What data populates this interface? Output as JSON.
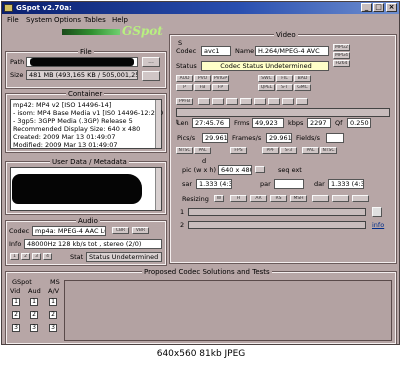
{
  "window": {
    "title": "GSpot v2.70a: "
  },
  "menu": [
    "File",
    "System",
    "Options",
    "Tables",
    "Help"
  ],
  "logo_text": "GSpot",
  "file": {
    "section_title": "File",
    "path_label": "Path",
    "size_label": "Size",
    "size_value": "481 MB (493,165 KB / 505,001,258",
    "button_dots": "..."
  },
  "container": {
    "section_title": "Container",
    "lines": [
      "mp42: MP4 v2 [ISO 14496-14]",
      "- isom: MP4  Base Media v1 [IS0 14496-12:200",
      "- 3gp5: 3GPP Media (.3GP) Release 5",
      "Recommended Display Size: 640 x 480",
      "Created:   2009 Mar 13   01:49:07",
      "Modified:  2009 Mar 13   01:49:07"
    ]
  },
  "metadata": {
    "section_title": "User Data / Metadata"
  },
  "audio": {
    "section_title": "Audio",
    "codec_label": "Codec",
    "codec_value": "mp4a: MPEG-4 AAC LC",
    "info_label": "Info",
    "info_value": "48000Hz  128 kb/s tot , stereo (2/0)",
    "status_label": "Stat",
    "status_value": "Status Undetermined",
    "buttons": [
      "CBR",
      "VBR"
    ],
    "tab_buttons": [
      "1",
      "2",
      "3",
      "4"
    ]
  },
  "video": {
    "section_title": "Video",
    "s_label": "S",
    "codec_label": "Codec",
    "codec_value": "avc1",
    "name_label": "Name",
    "name_value": "H.264/MPEG-4 AVC",
    "status_label": "Status",
    "status_value": "Codec Status Undetermined",
    "top_buttons": [
      "MPG2",
      "MPG4",
      "H264"
    ],
    "row1_buttons": [
      "AUD",
      "PVO",
      "PVIGP",
      "SWC",
      "FIL",
      "BAD"
    ],
    "row2_buttons": [
      "P",
      "FB",
      "FP",
      "QPEL",
      "S-T",
      "GMC"
    ],
    "row3_buttons": [
      "PPFB",
      "",
      "",
      "",
      "",
      "",
      "",
      "",
      ""
    ],
    "t_label": "t",
    "len_label": "Len",
    "len_value": "27:45.76",
    "frms_label": "Frms",
    "frms_value": "49,923",
    "kbps_label": "kbps",
    "kbps_value": "2297",
    "qf_label": "Qf",
    "qf_value": "0.250",
    "pics_label": "Pics/s",
    "pics_value": "29.961",
    "framers_label": "Frames/s",
    "framers_value": "29.961",
    "fields_label": "Fields/s",
    "mid_buttons": [
      "NTSC",
      "PAL",
      "FPS",
      "PPF",
      "S-3",
      "PAL",
      "NTSC"
    ],
    "d_label": "d",
    "pic_label": "pic (w x h)",
    "pic_value": "640 x 480",
    "aspect_label": "seq ext",
    "sar_label": "sar",
    "sar_value": "1.333 (4:3)",
    "par_label": "par",
    "dar_label": "dar",
    "dar_value": "1.333 (4:3)",
    "resizing_label": "Resizing",
    "resize_buttons": [
      "W",
      "H",
      "AR",
      "RS",
      "MSH"
    ],
    "row_1": "1",
    "row_2": "2",
    "info_link": "info"
  },
  "proposed": {
    "section_title": "Proposed Codec Solutions and Tests",
    "gspot_label": "GSpot",
    "vid_label": "Vid",
    "aud_label": "Aud",
    "ms_label": "MS",
    "av_label": "A/V",
    "rows": [
      "1",
      "2",
      "3"
    ]
  },
  "caption": "640x560  81kb  JPEG"
}
